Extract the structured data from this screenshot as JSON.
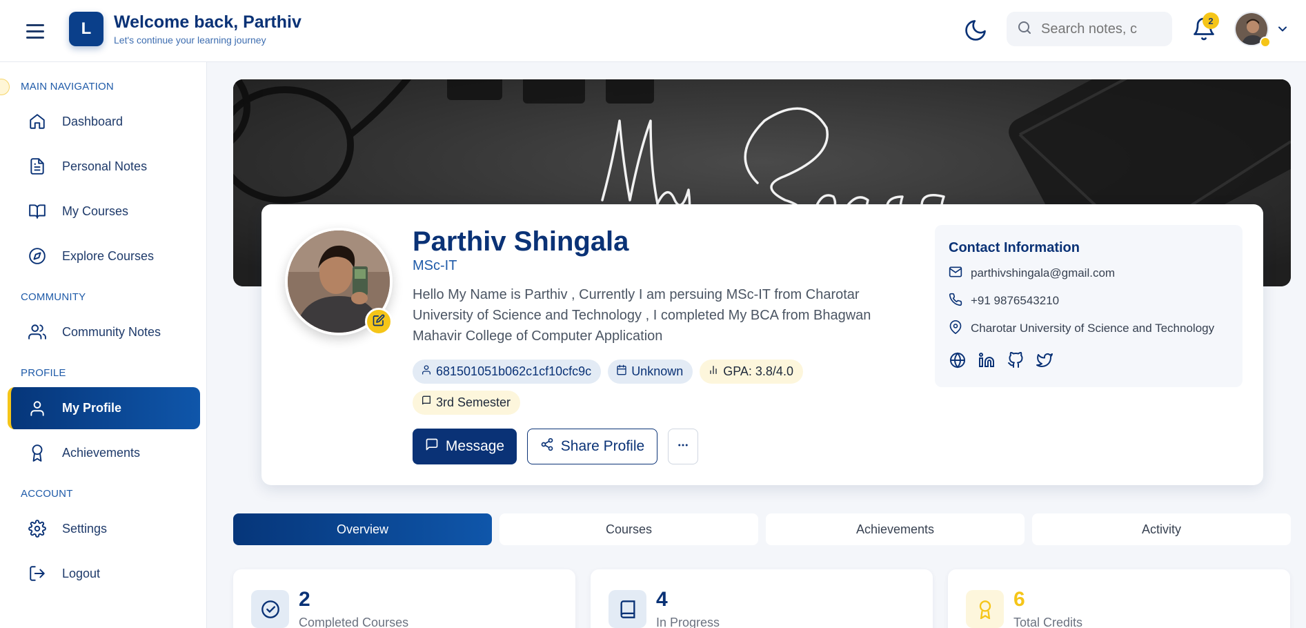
{
  "header": {
    "logo_letter": "L",
    "title": "Welcome back, Parthiv",
    "subtitle": "Let's continue your learning journey",
    "search_placeholder": "Search notes, c",
    "notification_count": "2"
  },
  "sidebar": {
    "sections": {
      "main": "MAIN NAVIGATION",
      "community": "COMMUNITY",
      "profile": "PROFILE",
      "account": "ACCOUNT"
    },
    "items": [
      {
        "label": "Dashboard",
        "icon": "home-icon"
      },
      {
        "label": "Personal Notes",
        "icon": "document-icon"
      },
      {
        "label": "My Courses",
        "icon": "book-open-icon"
      },
      {
        "label": "Explore Courses",
        "icon": "compass-icon"
      },
      {
        "label": "Community Notes",
        "icon": "users-icon"
      },
      {
        "label": "My Profile",
        "icon": "user-icon",
        "active": true
      },
      {
        "label": "Achievements",
        "icon": "award-icon"
      },
      {
        "label": "Settings",
        "icon": "gear-icon"
      },
      {
        "label": "Logout",
        "icon": "logout-icon"
      }
    ]
  },
  "banner": {
    "text": "My Space"
  },
  "profile": {
    "name": "Parthiv Shingala",
    "degree": "MSc-IT",
    "bio": "Hello My Name is Parthiv , Currently I am persuing MSc-IT from Charotar University of Science and Technology , I completed My BCA from Bhagwan Mahavir College of Computer Application",
    "chips": {
      "id": "681501051b062c1cf10cfc9c",
      "joined": "Unknown",
      "gpa": "GPA: 3.8/4.0",
      "semester": "3rd Semester"
    },
    "message_label": "Message",
    "share_label": "Share Profile"
  },
  "contact": {
    "title": "Contact Information",
    "email": "parthivshingala@gmail.com",
    "phone": "+91 9876543210",
    "location": "Charotar University of Science and Technology",
    "socials": [
      "globe-icon",
      "linkedin-icon",
      "github-icon",
      "twitter-icon"
    ]
  },
  "tabs": [
    "Overview",
    "Courses",
    "Achievements",
    "Activity"
  ],
  "stats": [
    {
      "value": "2",
      "label": "Completed Courses",
      "color": "#0a3276"
    },
    {
      "value": "4",
      "label": "In Progress",
      "color": "#0a3276"
    },
    {
      "value": "6",
      "label": "Total Credits",
      "color": "#f5c518"
    }
  ],
  "colors": {
    "primary": "#0a3276",
    "accent": "#f5c518",
    "background": "#f4f6fa"
  }
}
